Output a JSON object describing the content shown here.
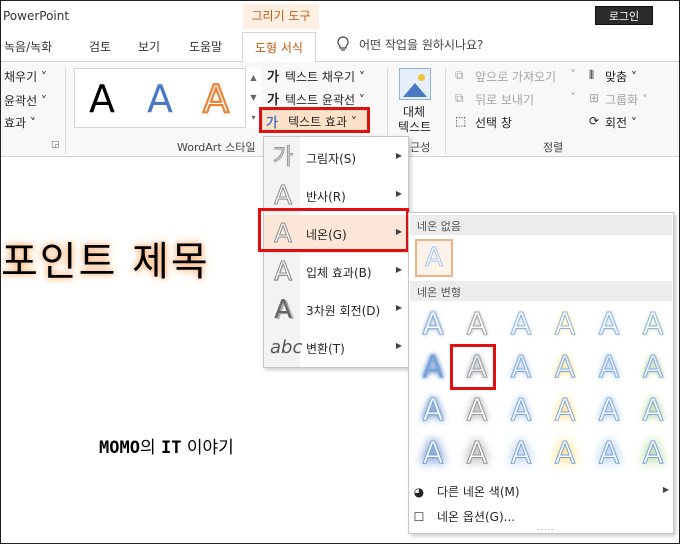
{
  "app": {
    "title": "PowerPoint",
    "context_tab": "그리기 도구",
    "login": "로그인"
  },
  "tabs": [
    "녹음/녹화",
    "검토",
    "보기",
    "도움말",
    "도형 서식"
  ],
  "tell_me": "어떤 작업을 원하시나요?",
  "ribbon": {
    "left_items": [
      "채우기 ˅",
      "윤곽선 ˅",
      "효과 ˅"
    ],
    "wordart_label": "WordArt 스타일",
    "text_fill": "텍스트 채우기 ˅",
    "text_outline": "텍스트 윤곽선 ˅",
    "text_effects": "텍스트 효과 ˅",
    "alt_text": [
      "대체",
      "텍스트"
    ],
    "alt_group_label": "근성",
    "bring_forward": "앞으로 가져오기",
    "send_backward": "뒤로 보내기",
    "selection_pane": "선택 창",
    "align": "맞춤 ˅",
    "group": "그룹화 ˅",
    "rotate": "회전 ˅",
    "arrange_label": "정렬"
  },
  "document": {
    "title_text": "포인트 제목",
    "subtitle_bold": "MOMO",
    "subtitle_mid": "의 ",
    "subtitle_it": "IT",
    "subtitle_rest": " 이야기"
  },
  "text_effects_menu": {
    "items": [
      {
        "label": "그림자(S)",
        "icon": "가"
      },
      {
        "label": "반사(R)",
        "icon": "A"
      },
      {
        "label": "네온(G)",
        "icon": "A"
      },
      {
        "label": "입체 효과(B)",
        "icon": "A"
      },
      {
        "label": "3차원 회전(D)",
        "icon": "A"
      },
      {
        "label": "변환(T)",
        "icon": "abc"
      }
    ]
  },
  "neon_submenu": {
    "no_glow_header": "네온 없음",
    "variations_header": "네온 변형",
    "more_colors": "다른 네온 색(M)",
    "options": "네온 옵션(G)...",
    "glow_colors": [
      "#4a78c2",
      "#a5a5a5",
      "#a9c4e8",
      "#ffd966",
      "#9dc3e6",
      "#a9d18e"
    ],
    "selected": {
      "row": 2,
      "column": 2
    }
  }
}
